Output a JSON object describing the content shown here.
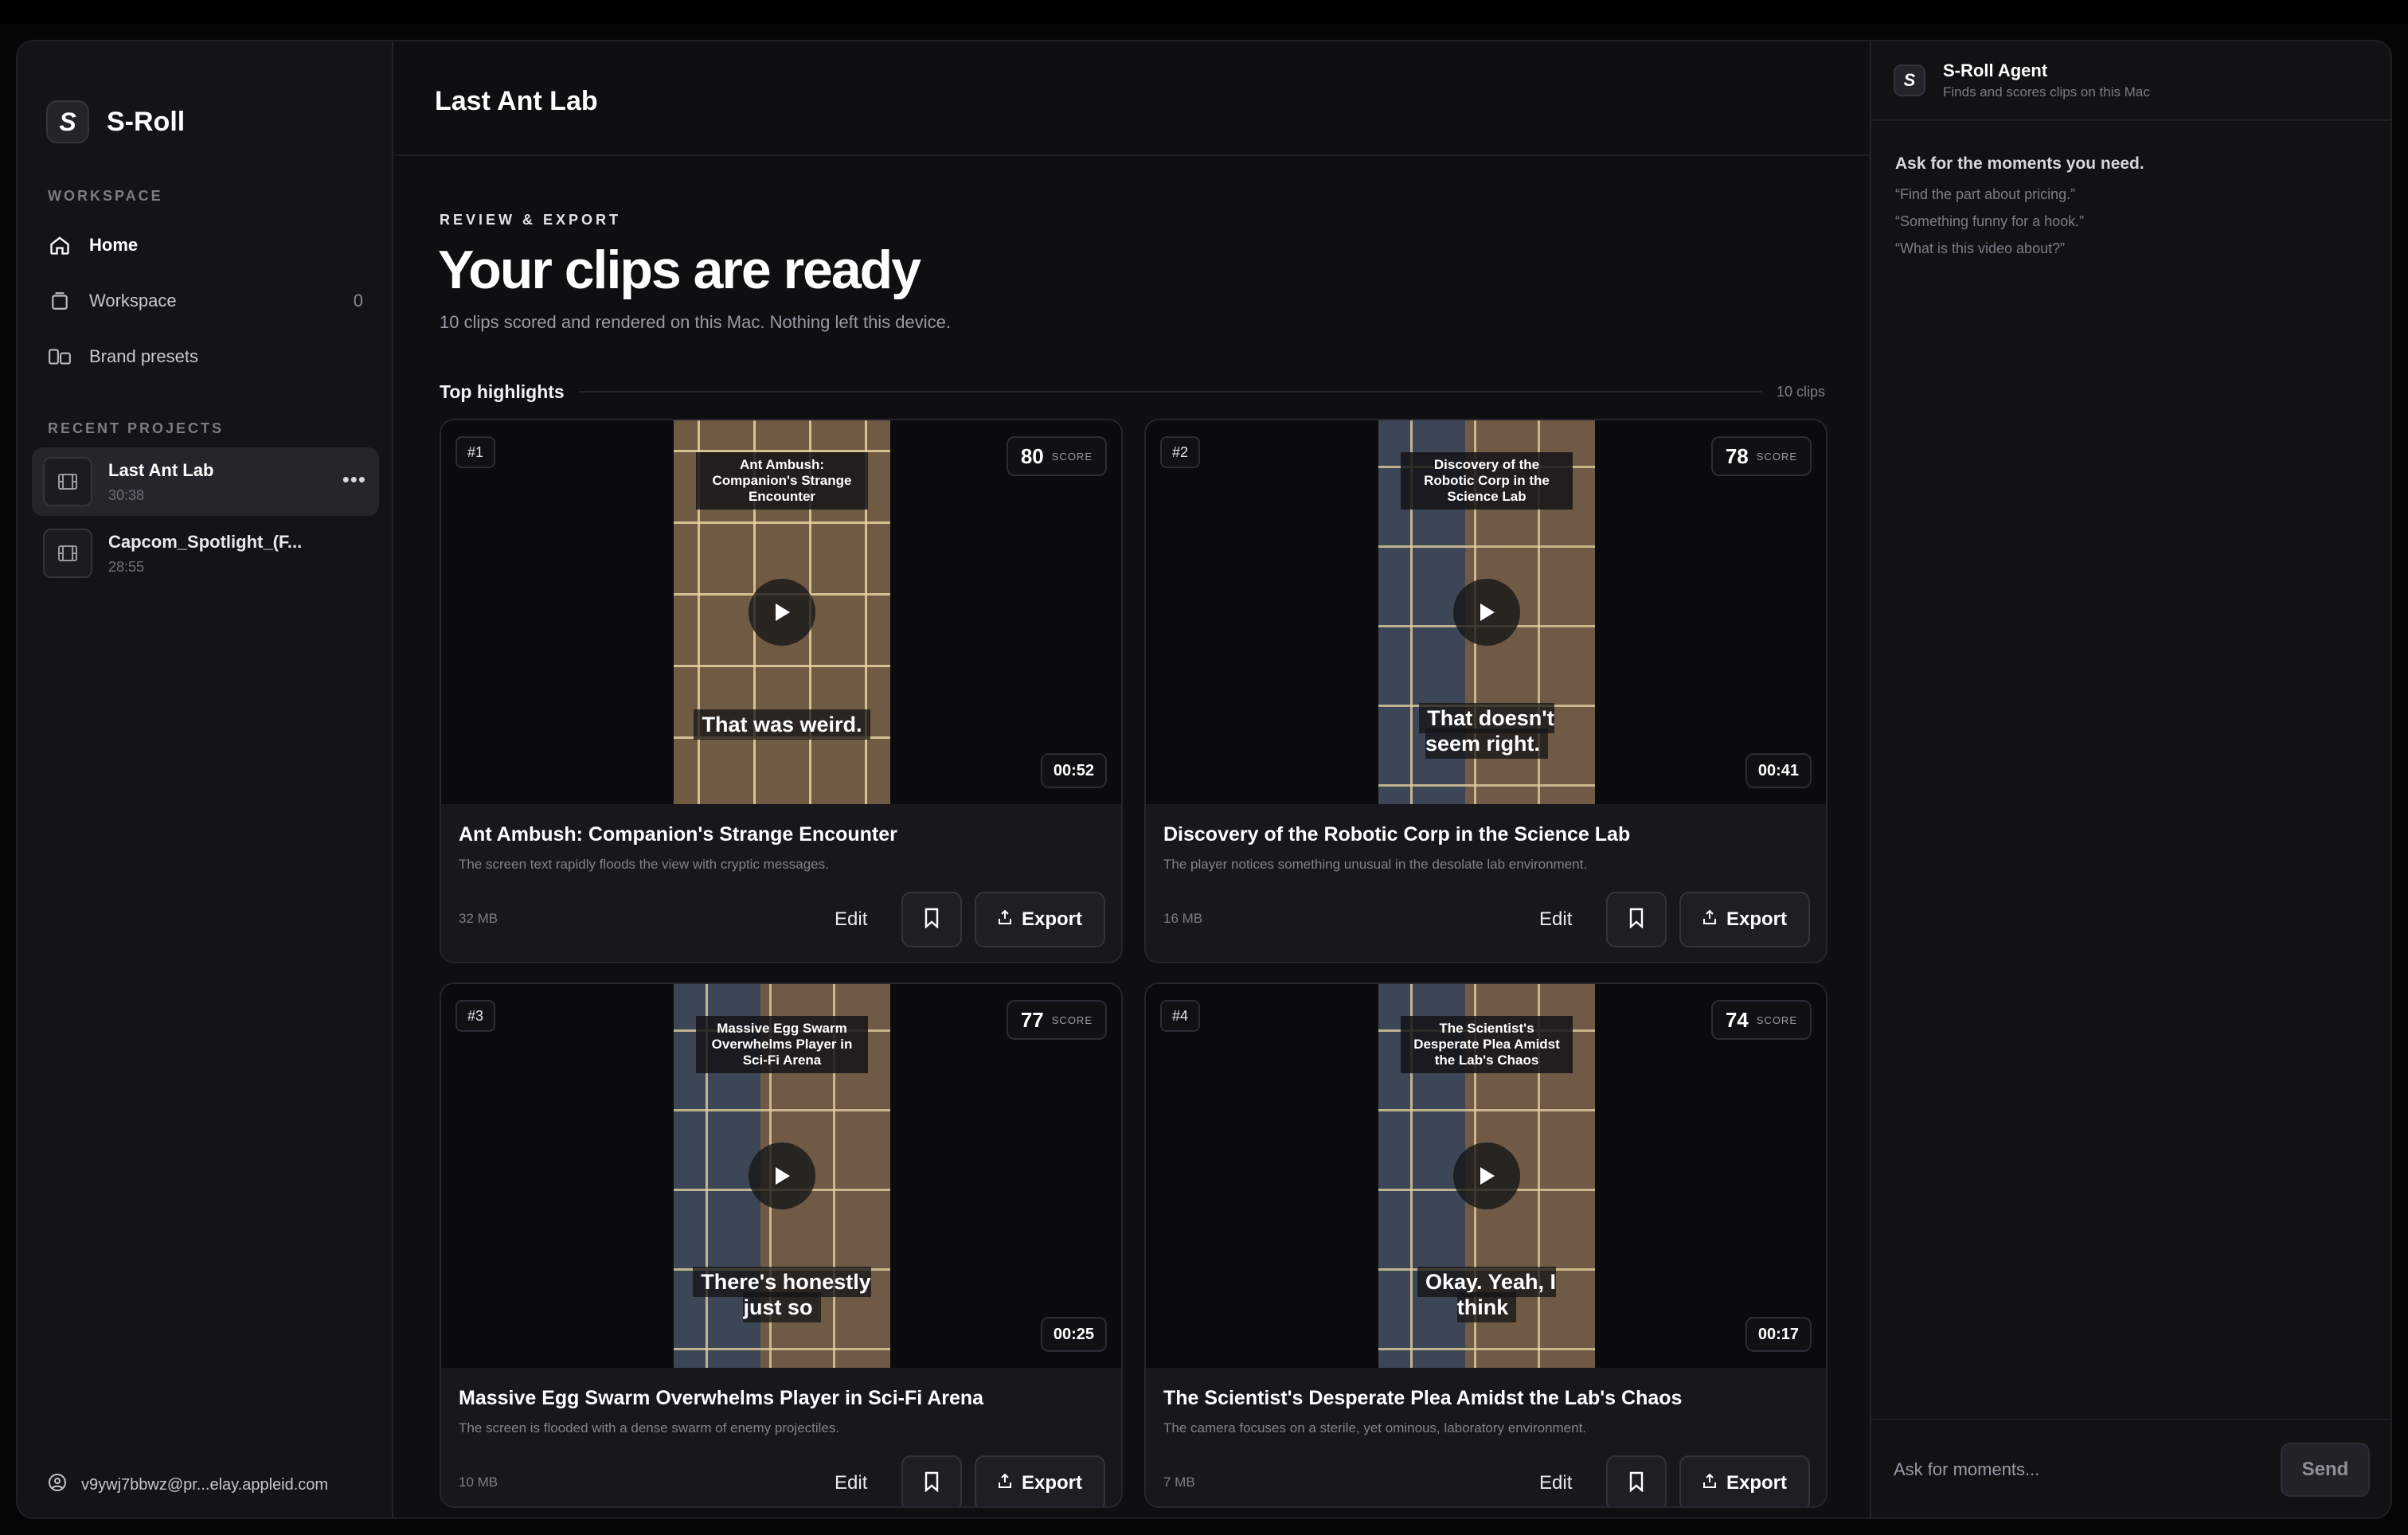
{
  "app": {
    "name": "S-Roll",
    "logo_letter": "S"
  },
  "sidebar": {
    "workspace_label": "WORKSPACE",
    "nav": [
      {
        "label": "Home",
        "icon": "home-icon",
        "active": true
      },
      {
        "label": "Workspace",
        "icon": "folder-icon",
        "count": "0"
      },
      {
        "label": "Brand presets",
        "icon": "presets-icon"
      }
    ],
    "recent_label": "RECENT PROJECTS",
    "projects": [
      {
        "title": "Last Ant Lab",
        "duration": "30:38",
        "active": true
      },
      {
        "title": "Capcom_Spotlight_(F...",
        "duration": "28:55"
      }
    ],
    "account_email": "v9ywj7bbwz@pr...elay.appleid.com"
  },
  "main": {
    "project_title": "Last Ant Lab",
    "kicker": "REVIEW & EXPORT",
    "headline": "Your clips are ready",
    "subline": "10 clips scored and rendered on this Mac. Nothing left this device.",
    "section_title": "Top highlights",
    "section_count": "10 clips",
    "edit_label": "Edit",
    "export_label": "Export",
    "score_label": "SCORE",
    "clips": [
      {
        "rank": "#1",
        "score": "80",
        "duration": "00:52",
        "overlay_title": "Ant Ambush: Companion's Strange Encounter",
        "caption": "That was weird.",
        "title": "Ant Ambush: Companion's Strange Encounter",
        "desc": "The screen text rapidly floods the view with cryptic messages.",
        "size": "32 MB"
      },
      {
        "rank": "#2",
        "score": "78",
        "duration": "00:41",
        "overlay_title": "Discovery of the Robotic Corp in the Science Lab",
        "caption": "That doesn't seem right.",
        "title": "Discovery of the Robotic Corp in the Science Lab",
        "desc": "The player notices something unusual in the desolate lab environment.",
        "size": "16 MB"
      },
      {
        "rank": "#3",
        "score": "77",
        "duration": "00:25",
        "overlay_title": "Massive Egg Swarm Overwhelms Player in Sci-Fi Arena",
        "caption": "There's honestly just so",
        "title": "Massive Egg Swarm Overwhelms Player in Sci-Fi Arena",
        "desc": "The screen is flooded with a dense swarm of enemy projectiles.",
        "size": "10 MB"
      },
      {
        "rank": "#4",
        "score": "74",
        "duration": "00:17",
        "overlay_title": "The Scientist's Desperate Plea Amidst the Lab's Chaos",
        "caption": "Okay. Yeah, I think",
        "title": "The Scientist's Desperate Plea Amidst the Lab's Chaos",
        "desc": "The camera focuses on a sterile, yet ominous, laboratory environment.",
        "size": "7 MB"
      }
    ]
  },
  "agent": {
    "name": "S-Roll Agent",
    "subtitle": "Finds and scores clips on this Mac",
    "prompt": "Ask for the moments you need.",
    "examples": [
      "“Find the part about pricing.”",
      "“Something funny for a hook.”",
      "“What is this video about?”"
    ],
    "input_placeholder": "Ask for moments...",
    "send_label": "Send"
  }
}
